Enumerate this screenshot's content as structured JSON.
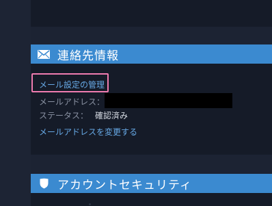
{
  "contact_section": {
    "icon": "envelope-icon",
    "title": "連絡先情報",
    "manage_mail_link": "メール設定の管理",
    "email_label": "メールアドレス：",
    "status_label": "ステータス：",
    "status_value": "確認済み",
    "change_email_link": "メールアドレスを変更する"
  },
  "security_section": {
    "icon": "shield-icon",
    "title": "アカウントセキュリティ"
  },
  "colors": {
    "band": "#3b8ad0",
    "link": "#67a9e6",
    "highlight": "#f07cb0",
    "panel": "#151b28"
  }
}
